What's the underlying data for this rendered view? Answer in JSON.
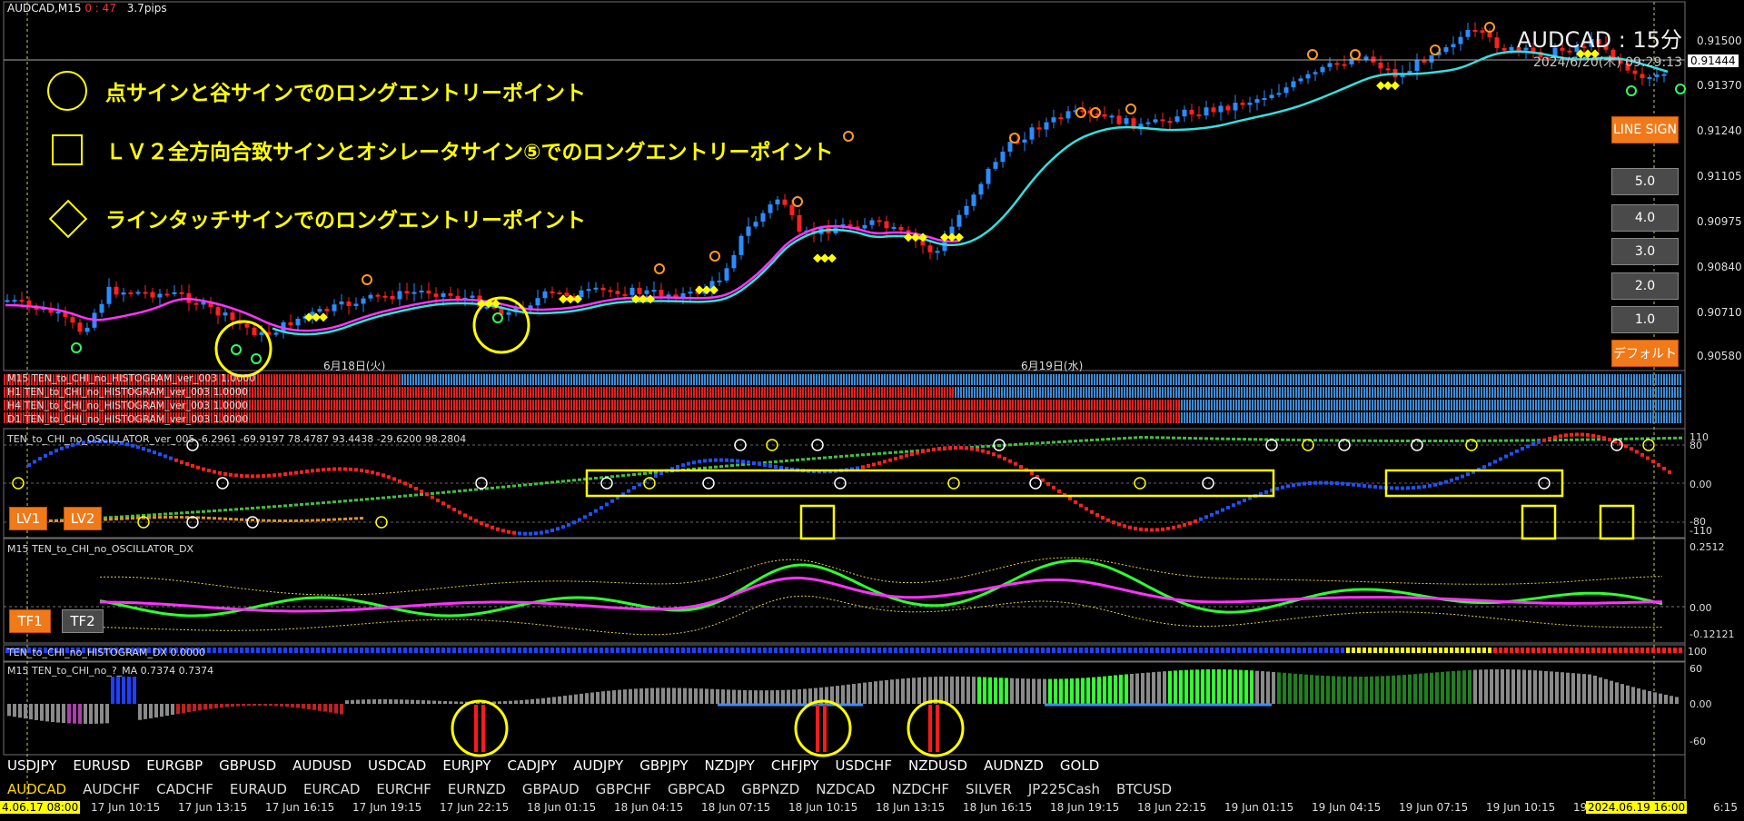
{
  "window": {
    "symbol": "AUDCAD,M15",
    "countdown": "0 : 47",
    "spread": "3.7pips",
    "big_title": "AUDCAD : 15分",
    "big_time": "2024/6/20(木) 09:29:13"
  },
  "legend": [
    {
      "shape": "circle",
      "text": "点サインと谷サインでのロングエントリーポイント"
    },
    {
      "shape": "square",
      "text": "ＬＶ２全方向合致サインとオシレータサイン⑤でのロングエントリーポイント"
    },
    {
      "shape": "diamond",
      "text": "ラインタッチサインでのロングエントリーポイント"
    }
  ],
  "price_axis": [
    "0.91500",
    "0.91444",
    "0.91370",
    "0.91240",
    "0.91105",
    "0.90975",
    "0.90840",
    "0.90710",
    "0.90580"
  ],
  "date_labels": [
    "6月18日(火)",
    "6月19日(水)"
  ],
  "right_panel": {
    "line_sign": "LINE SIGN",
    "levels": [
      "5.0",
      "4.0",
      "3.0",
      "2.0",
      "1.0"
    ],
    "default": "デフォルト"
  },
  "histograms": [
    "M15 TEN_to_CHI_no_HISTOGRAM_ver_003 1.0000",
    "H1 TEN_to_CHI_no_HISTOGRAM_ver_003 1.0000",
    "H4 TEN_to_CHI_no_HISTOGRAM_ver_003 1.0000",
    "D1 TEN_to_CHI_no_HISTOGRAM_ver_003 1.0000"
  ],
  "oscillator": {
    "label": "TEN_to_CHI_no_OSCILLATOR_ver_005 -6.2961 -69.9197 78.4787 93.4438 -29.6200 98.2804",
    "axis": [
      "110",
      "80",
      "0.00",
      "-80",
      "-110"
    ],
    "btn_lv1": "LV1",
    "btn_lv2": "LV2"
  },
  "dx": {
    "label": "M15 TEN_to_CHI_no_OSCILLATOR_DX",
    "axis": [
      "0.2512",
      "0.00",
      "-0.12121"
    ],
    "btn_tf1": "TF1",
    "btn_tf2": "TF2"
  },
  "dx_hist": {
    "label": "TEN_to_CHI_no_HISTOGRAM_DX 0.0000",
    "axis": "100"
  },
  "ma": {
    "label": "M15 TEN_to_CHI_no_?_MA 0.7374 0.7374",
    "axis": [
      "60",
      "0.00",
      "-60"
    ]
  },
  "symbols_row1": [
    "USDJPY",
    "EURUSD",
    "EURGBP",
    "GBPUSD",
    "AUDUSD",
    "USDCAD",
    "EURJPY",
    "CADJPY",
    "AUDJPY",
    "GBPJPY",
    "NZDJPY",
    "CHFJPY",
    "USDCHF",
    "NZDUSD",
    "AUDNZD",
    "GOLD"
  ],
  "symbols_row2": [
    "AUDCAD",
    "AUDCHF",
    "CADCHF",
    "EURAUD",
    "EURCAD",
    "EURCHF",
    "EURNZD",
    "GBPAUD",
    "GBPCHF",
    "GBPCAD",
    "GBPNZD",
    "NZDCAD",
    "NZDCHF",
    "SILVER",
    "JP225Cash",
    "BTCUSD"
  ],
  "active_symbol": "AUDCAD",
  "time_axis": [
    "17 Jun 10:15",
    "17 Jun 13:15",
    "17 Jun 16:15",
    "17 Jun 19:15",
    "17 Jun 22:15",
    "18 Jun 01:15",
    "18 Jun 04:15",
    "18 Jun 07:15",
    "18 Jun 10:15",
    "18 Jun 13:15",
    "18 Jun 16:15",
    "18 Jun 19:15",
    "18 Jun 22:15",
    "19 Jun 01:15",
    "19 Jun 04:15",
    "19 Jun 07:15",
    "19 Jun 10:15",
    "19 Jun"
  ],
  "time_start": "4.06.17 08:00",
  "time_cursor": "2024.06.19 16:00",
  "time_end": "6:15",
  "colors": {
    "bull": "#2a8cff",
    "bear": "#ff2020",
    "ma_fast": "#ff33ff",
    "ma_slow": "#33e0e0",
    "signal": "#ffff00",
    "hist_blue": "#3a8cd8",
    "hist_red": "#e02020"
  }
}
